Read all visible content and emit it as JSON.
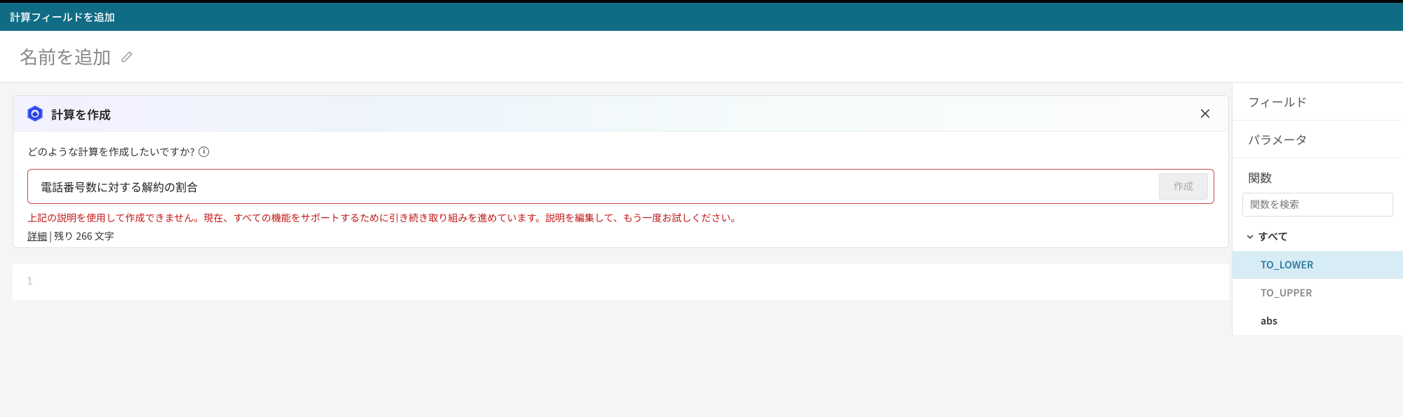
{
  "header": {
    "title": "計算フィールドを追加"
  },
  "name_row": {
    "placeholder": "名前を追加"
  },
  "calc_card": {
    "title": "計算を作成",
    "prompt": "どのような計算を作成したいですか?",
    "input_value": "電話番号数に対する解約の割合",
    "create_button": "作成",
    "error": "上記の説明を使用して作成できません。現在、すべての機能をサポートするために引き続き取り組みを進めています。説明を編集して、もう一度お試しください。",
    "detail_link": "詳細",
    "remaining_text": "残り 266 文字",
    "code_line_no": "1"
  },
  "sidebar": {
    "tabs": {
      "fields": "フィールド",
      "parameters": "パラメータ"
    },
    "functions_title": "関数",
    "search_placeholder": "関数を検索",
    "group_all": "すべて",
    "items": [
      {
        "label": "TO_LOWER",
        "state": "sel"
      },
      {
        "label": "TO_UPPER",
        "state": "unsel"
      },
      {
        "label": "abs",
        "state": "norm"
      }
    ]
  }
}
